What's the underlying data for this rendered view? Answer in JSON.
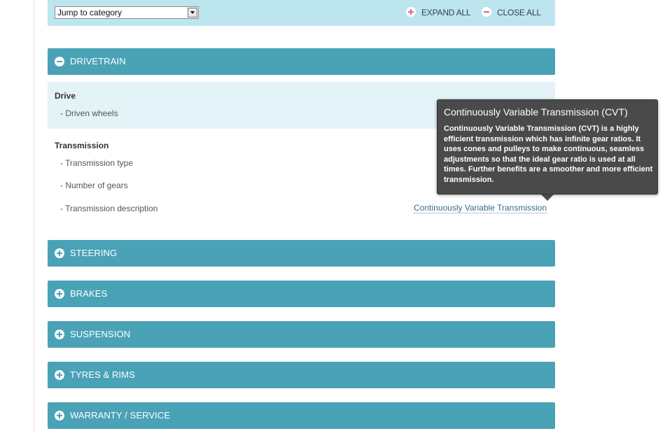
{
  "toolbar": {
    "jump_select_value": "Jump to category",
    "expand_all_label": "EXPAND ALL",
    "close_all_label": "CLOSE ALL"
  },
  "sections": [
    {
      "title": "DRIVETRAIN",
      "state": "expanded",
      "icon": "minus-circle-icon"
    },
    {
      "title": "STEERING",
      "state": "collapsed",
      "icon": "plus-circle-icon"
    },
    {
      "title": "BRAKES",
      "state": "collapsed",
      "icon": "plus-circle-icon"
    },
    {
      "title": "SUSPENSION",
      "state": "collapsed",
      "icon": "plus-circle-icon"
    },
    {
      "title": "TYRES & RIMS",
      "state": "collapsed",
      "icon": "plus-circle-icon"
    },
    {
      "title": "WARRANTY / SERVICE",
      "state": "collapsed",
      "icon": "plus-circle-icon"
    }
  ],
  "drivetrain": {
    "drive": {
      "title": "Drive",
      "rows": [
        {
          "label": "- Driven wheels",
          "value": ""
        }
      ]
    },
    "transmission": {
      "title": "Transmission",
      "rows": [
        {
          "label": "- Transmission type",
          "value": ""
        },
        {
          "label": "- Number of gears",
          "value": ""
        },
        {
          "label": "- Transmission description",
          "value": "Continuously Variable Transmission"
        }
      ]
    }
  },
  "tooltip": {
    "title": "Continuously Variable Transmission (CVT)",
    "body": "Continuously Variable Transmission (CVT) is a highly efficient transmission which has infinite gear ratios. It uses cones and pulleys to make continuous, seamless adjustments so that the ideal gear ratio is used at all times. Further benefits are a smoother and more efficient transmission."
  },
  "colors": {
    "toolbar_bg": "#bde5f0",
    "section_bar": "#4aa2b7",
    "shaded_group": "#e3f3f8",
    "tooltip_bg": "#4a4a4a",
    "toolbar_icon_accent": "#e0608a"
  }
}
